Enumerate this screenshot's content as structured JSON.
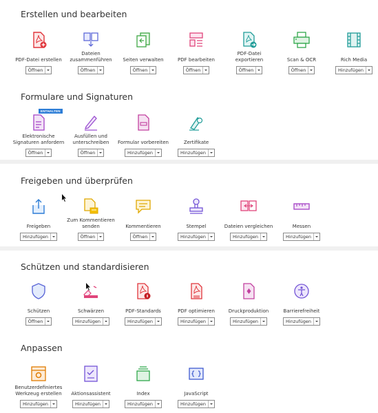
{
  "colors": {
    "section_bg": "#ffffff",
    "page_bg": "#f0f0f0",
    "badge_bg": "#2d7dd6"
  },
  "sections": [
    {
      "title": "Erstellen und bearbeiten",
      "tools": [
        {
          "label": "PDF-Datei erstellen",
          "button": "Öffnen",
          "icon": "create-pdf-icon"
        },
        {
          "label": "Dateien zusammenführen",
          "button": "Öffnen",
          "icon": "combine-files-icon"
        },
        {
          "label": "Seiten verwalten",
          "button": "Öffnen",
          "icon": "organize-pages-icon"
        },
        {
          "label": "PDF bearbeiten",
          "button": "Öffnen",
          "icon": "edit-pdf-icon"
        },
        {
          "label": "PDF-Datei exportieren",
          "button": "Öffnen",
          "icon": "export-pdf-icon"
        },
        {
          "label": "Scan & OCR",
          "button": "Öffnen",
          "icon": "scan-ocr-icon"
        },
        {
          "label": "Rich Media",
          "button": "Hinzufügen",
          "icon": "rich-media-icon"
        }
      ]
    },
    {
      "title": "Formulare und Signaturen",
      "badge": "ENTHALTEN",
      "tools": [
        {
          "label": "Elektronische Signaturen anfordern",
          "button": "Öffnen",
          "icon": "request-signatures-icon"
        },
        {
          "label": "Ausfüllen und unterschreiben",
          "button": "Öffnen",
          "icon": "fill-sign-icon"
        },
        {
          "label": "Formular vorbereiten",
          "button": "Hinzufügen",
          "icon": "prepare-form-icon"
        },
        {
          "label": "Zertifikate",
          "button": "Hinzufügen",
          "icon": "certificates-icon"
        }
      ]
    },
    {
      "title": "Freigeben und überprüfen",
      "tools": [
        {
          "label": "Freigeben",
          "button": "Hinzufügen",
          "icon": "share-icon"
        },
        {
          "label": "Zum Kommentieren senden",
          "button": "Öffnen",
          "icon": "send-for-comments-icon"
        },
        {
          "label": "Kommentieren",
          "button": "Öffnen",
          "icon": "comment-icon"
        },
        {
          "label": "Stempel",
          "button": "Hinzufügen",
          "icon": "stamp-icon"
        },
        {
          "label": "Dateien vergleichen",
          "button": "Hinzufügen",
          "icon": "compare-files-icon"
        },
        {
          "label": "Messen",
          "button": "Hinzufügen",
          "icon": "measure-icon"
        }
      ]
    },
    {
      "title": "Schützen und standardisieren",
      "tools": [
        {
          "label": "Schützen",
          "button": "Öffnen",
          "icon": "protect-icon"
        },
        {
          "label": "Schwärzen",
          "button": "Hinzufügen",
          "icon": "redact-icon"
        },
        {
          "label": "PDF-Standards",
          "button": "Hinzufügen",
          "icon": "pdf-standards-icon"
        },
        {
          "label": "PDF optimieren",
          "button": "Hinzufügen",
          "icon": "optimize-pdf-icon"
        },
        {
          "label": "Druckproduktion",
          "button": "Hinzufügen",
          "icon": "print-production-icon"
        },
        {
          "label": "Barrierefreiheit",
          "button": "Hinzufügen",
          "icon": "accessibility-icon"
        }
      ]
    },
    {
      "title": "Anpassen",
      "tools": [
        {
          "label": "Benutzerdefiniertes Werkzeug erstellen",
          "button": "Hinzufügen",
          "icon": "create-custom-tool-icon"
        },
        {
          "label": "Aktionsassistent",
          "button": "Hinzufügen",
          "icon": "action-wizard-icon"
        },
        {
          "label": "Index",
          "button": "Hinzufügen",
          "icon": "index-icon"
        },
        {
          "label": "JavaScript",
          "button": "Hinzufügen",
          "icon": "javascript-icon"
        }
      ]
    }
  ]
}
